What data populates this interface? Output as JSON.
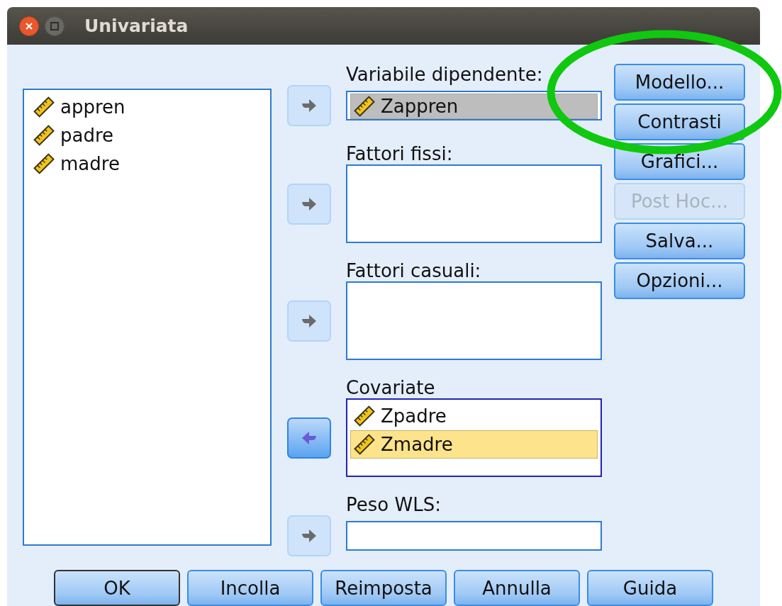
{
  "window": {
    "title": "Univariata"
  },
  "source_list": {
    "items": [
      {
        "label": "appren",
        "selected": false
      },
      {
        "label": "padre",
        "selected": false
      },
      {
        "label": "madre",
        "selected": false
      }
    ]
  },
  "targets": [
    {
      "label": "Variabile dipendente:",
      "kind": "single",
      "focused": false,
      "arrow": {
        "kind": "right",
        "enabled": false
      },
      "items": [
        {
          "label": "Zappren",
          "selected": true
        }
      ]
    },
    {
      "label": "Fattori fissi:",
      "kind": "list",
      "focused": false,
      "arrow": {
        "kind": "right",
        "enabled": false
      }
    },
    {
      "label": "Fattori casuali:",
      "kind": "list",
      "focused": false,
      "arrow": {
        "kind": "right",
        "enabled": false
      }
    },
    {
      "label": "Covariate",
      "kind": "list",
      "focused": true,
      "arrow": {
        "kind": "left",
        "enabled": true
      },
      "items": [
        {
          "label": "Zpadre",
          "selected": false
        },
        {
          "label": "Zmadre",
          "selected": true
        }
      ]
    },
    {
      "label": "Peso WLS:",
      "kind": "single",
      "focused": false,
      "arrow": {
        "kind": "right",
        "enabled": false
      }
    }
  ],
  "side_buttons": [
    {
      "label": "Modello...",
      "disabled": false
    },
    {
      "label": "Contrasti",
      "disabled": false
    },
    {
      "label": "Grafici...",
      "disabled": false
    },
    {
      "label": "Post Hoc...",
      "disabled": true
    },
    {
      "label": "Salva...",
      "disabled": false
    },
    {
      "label": "Opzioni...",
      "disabled": false
    }
  ],
  "bottom_buttons": [
    {
      "label": "OK",
      "default": true
    },
    {
      "label": "Incolla",
      "default": false
    },
    {
      "label": "Reimposta",
      "default": false
    },
    {
      "label": "Annulla",
      "default": false
    },
    {
      "label": "Guida",
      "default": false
    }
  ],
  "annotation": {
    "kind": "ellipse"
  }
}
